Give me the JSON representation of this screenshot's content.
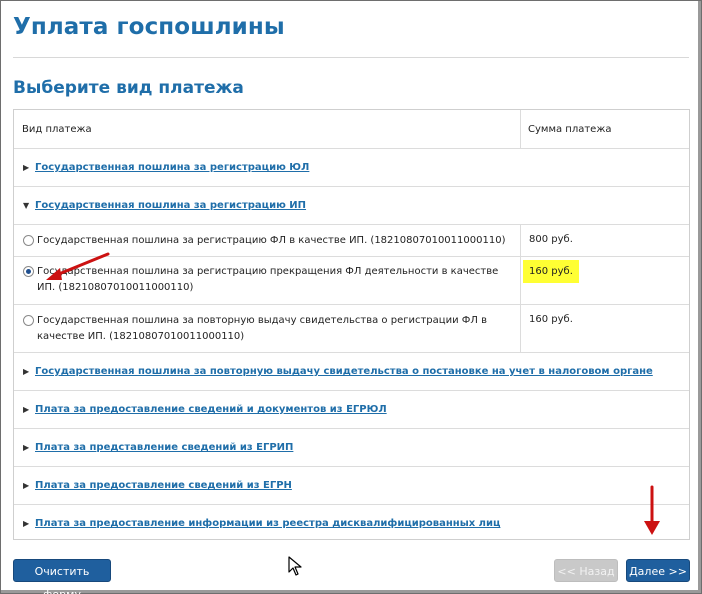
{
  "page": {
    "title": "Уплата госпошлины",
    "section_title": "Выберите вид платежа"
  },
  "table": {
    "col_type": "Вид платежа",
    "col_sum": "Сумма платежа",
    "groups_top": [
      {
        "label": "Государственная пошлина за регистрацию ЮЛ",
        "expanded": false
      },
      {
        "label": "Государственная пошлина за регистрацию ИП",
        "expanded": true
      }
    ],
    "options": [
      {
        "label": "Государственная пошлина за регистрацию ФЛ в качестве ИП. (18210807010011000110)",
        "price": "800 руб.",
        "selected": false
      },
      {
        "label": "Государственная пошлина за регистрацию прекращения ФЛ деятельности в качестве ИП. (18210807010011000110)",
        "price": "160 руб.",
        "selected": true
      },
      {
        "label": "Государственная пошлина за повторную выдачу свидетельства о регистрации ФЛ в качестве ИП. (18210807010011000110)",
        "price": "160 руб.",
        "selected": false
      }
    ],
    "groups_bottom": [
      {
        "label": "Государственная пошлина за повторную выдачу свидетельства о постановке на учет в налоговом органе"
      },
      {
        "label": "Плата за предоставление сведений и документов из ЕГРЮЛ"
      },
      {
        "label": "Плата за представление сведений из ЕГРИП"
      },
      {
        "label": "Плата за предоставление сведений из ЕГРН"
      },
      {
        "label": "Плата за предоставление информации из реестра дисквалифицированных лиц"
      }
    ]
  },
  "buttons": {
    "clear": "Очистить форму",
    "back": "<< Назад",
    "next": "Далее >>"
  },
  "colors": {
    "accent": "#1f6ea9",
    "button": "#1f5f9e",
    "highlight": "#ffff33",
    "annotation_arrow": "#cc1111"
  }
}
